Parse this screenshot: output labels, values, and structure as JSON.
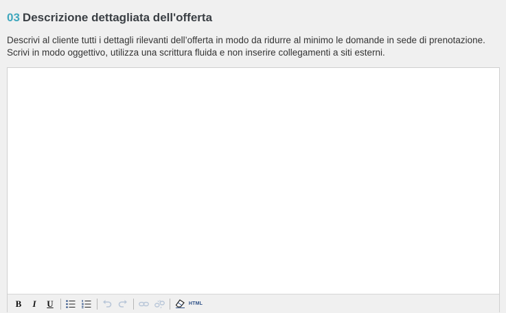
{
  "section": {
    "number": "03",
    "title": "Descrizione dettagliata dell'offerta",
    "description": "Descrivi al cliente tutti i dettagli rilevanti dell’offerta in modo da ridurre al minimo le domande in sede di prenotazione. Scrivi in modo oggettivo, utilizza una scrittura fluida e non inserire collegamenti a siti esterni."
  },
  "editor": {
    "content": "",
    "toolbar": {
      "bold_label": "B",
      "italic_label": "I",
      "underline_label": "U",
      "html_label": "HTML",
      "icons": [
        "bold-icon",
        "italic-icon",
        "underline-icon",
        "bullet-list-icon",
        "numbered-list-icon",
        "undo-icon",
        "redo-icon",
        "link-icon",
        "unlink-icon",
        "eraser-icon",
        "html-source-icon"
      ],
      "disabled": [
        "undo-icon",
        "redo-icon",
        "link-icon",
        "unlink-icon"
      ]
    }
  },
  "colors": {
    "accent": "#3fa7bd",
    "title": "#3a3f44",
    "background": "#f0f0f0",
    "disabled_icon": "#b8c6d8"
  }
}
